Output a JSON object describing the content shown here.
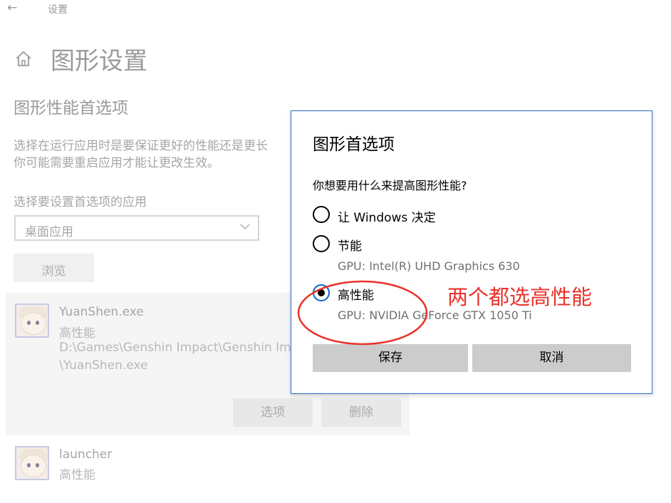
{
  "topbar": {
    "back_glyph": "←",
    "title": "设置"
  },
  "page": {
    "title": "图形设置"
  },
  "section": {
    "title": "图形性能首选项",
    "description_line1": "选择在运行应用时是要保证更好的性能还是更长",
    "description_line2": "你可能需要重启应用才能让更改生效。",
    "select_label": "选择要设置首选项的应用",
    "select_value": "桌面应用",
    "browse_label": "浏览"
  },
  "apps": [
    {
      "name": "YuanShen.exe",
      "preference": "高性能",
      "path_line1": "D:\\Games\\Genshin Impact\\Genshin Imp",
      "path_line2": "\\YuanShen.exe",
      "options_label": "选项",
      "remove_label": "删除"
    },
    {
      "name": "launcher",
      "preference": "高性能"
    }
  ],
  "dialog": {
    "title": "图形首选项",
    "question": "你想要用什么来提高图形性能?",
    "options": [
      {
        "label": "让 Windows 决定",
        "gpu": "",
        "checked": false
      },
      {
        "label": "节能",
        "gpu": "GPU: Intel(R) UHD Graphics 630",
        "checked": false
      },
      {
        "label": "高性能",
        "gpu": "GPU: NVIDIA GeForce GTX 1050 Ti",
        "checked": true
      }
    ],
    "save_label": "保存",
    "cancel_label": "取消"
  },
  "annotation": {
    "text": "两个都选高性能",
    "color": "#e8322b"
  },
  "colors": {
    "accent": "#0a63c9",
    "dialog_border": "#2d6bcd"
  },
  "icons": [
    "back-arrow-icon",
    "home-icon",
    "chevron-down-icon",
    "app-icon",
    "radio-icon"
  ]
}
